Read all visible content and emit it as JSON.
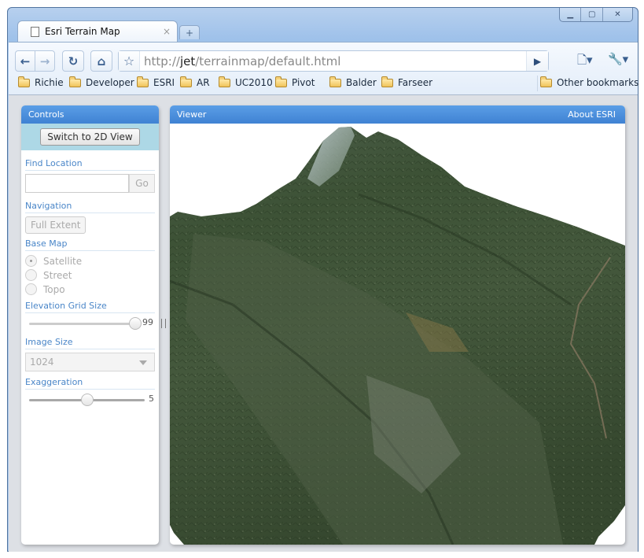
{
  "browser": {
    "tab_title": "Esri Terrain Map",
    "tab_close": "×",
    "new_tab": "+",
    "url_prefix": "http://",
    "url_host": "jet",
    "url_path": "/terrainmap/default.html",
    "window_controls": [
      "–",
      "□",
      "X"
    ],
    "bookmarks": [
      "Richie",
      "Developer",
      "ESRI",
      "AR",
      "UC2010",
      "Pivot",
      "Balder",
      "Farseer"
    ],
    "other_bookmarks": "Other bookmarks"
  },
  "controls": {
    "title": "Controls",
    "switch_view_label": "Switch to 2D View",
    "find_location": {
      "label": "Find Location",
      "value": "",
      "placeholder": "",
      "go_label": "Go"
    },
    "navigation": {
      "label": "Navigation",
      "full_extent_label": "Full Extent"
    },
    "base_map": {
      "label": "Base Map",
      "options": [
        "Satellite",
        "Street",
        "Topo"
      ],
      "selected": "Satellite"
    },
    "elevation_grid_size": {
      "label": "Elevation Grid Size",
      "value": "99",
      "fraction": 1.0
    },
    "image_size": {
      "label": "Image Size",
      "selected": "1024"
    },
    "exaggeration": {
      "label": "Exaggeration",
      "value": "5",
      "fraction": 0.5
    }
  },
  "viewer": {
    "title": "Viewer",
    "about_link": "About ESRI",
    "content": "3D satellite terrain rendering of a mountain and valley"
  }
}
